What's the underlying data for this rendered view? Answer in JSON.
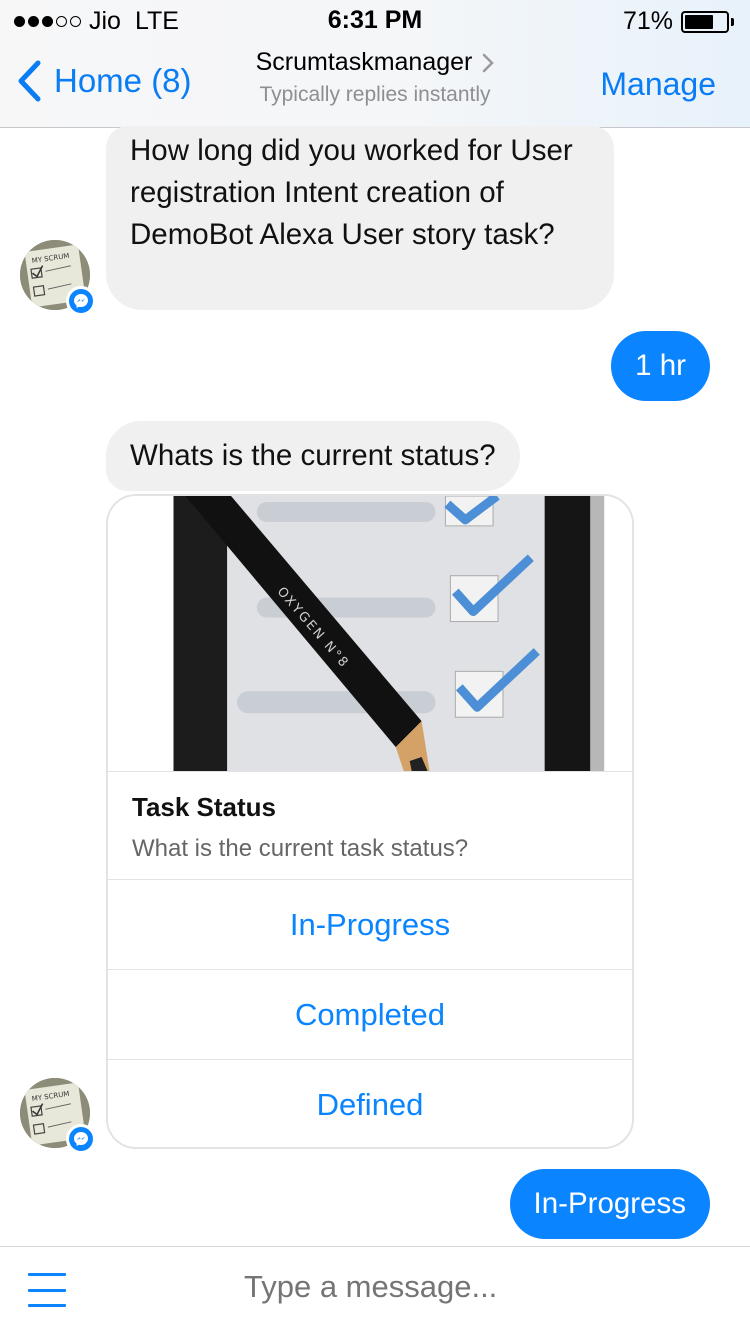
{
  "status_bar": {
    "carrier": "Jio",
    "network": "LTE",
    "time": "6:31 PM",
    "battery_percent": "71%",
    "battery_level": 0.71,
    "signal_bars": 3,
    "signal_max": 5
  },
  "nav": {
    "back_label": "Home (8)",
    "title": "Scrumtaskmanager",
    "subtitle": "Typically replies instantly",
    "manage_label": "Manage"
  },
  "messages": [
    {
      "from": "bot",
      "text": "How long did you worked for User registration Intent creation of DemoBot Alexa User story task?"
    },
    {
      "from": "user",
      "text": "1 hr"
    },
    {
      "from": "bot",
      "text": "Whats is the current status?"
    },
    {
      "from": "user",
      "text": "In-Progress"
    }
  ],
  "card": {
    "title": "Task Status",
    "subtitle": "What is the current task status?",
    "image_icon": "checklist-pencil-image",
    "pencil_text": "OXYGEN N°8",
    "buttons": [
      "In-Progress",
      "Completed",
      "Defined"
    ]
  },
  "avatar": {
    "icon": "scrum-notebook-avatar",
    "text": "MY SCRUM"
  },
  "composer": {
    "placeholder": "Type a message..."
  },
  "colors": {
    "accent": "#0a84ff",
    "nav_accent": "#0a7cf4",
    "bubble_in": "#f0f0f0",
    "border": "#e3e3e6"
  }
}
